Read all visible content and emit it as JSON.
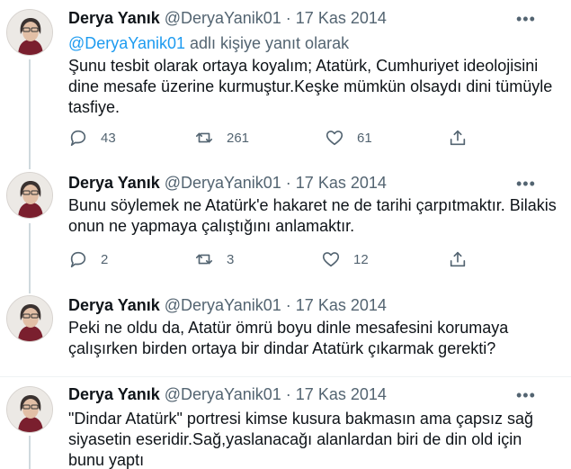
{
  "tweets": [
    {
      "name": "Derya Yanık",
      "handle": "@DeryaYanik01",
      "separator": "·",
      "date": "17 Kas 2014",
      "reply_mention": "@DeryaYanik01",
      "reply_suffix": " adlı kişiye yanıt olarak",
      "text": "Şunu tesbit olarak ortaya koyalım; Atatürk, Cumhuriyet ideolojisini dine mesafe üzerine kurmuştur.Keşke mümkün olsaydı dini tümüyle tasfiye.",
      "replies": "43",
      "retweets": "261",
      "likes": "61"
    },
    {
      "name": "Derya Yanık",
      "handle": "@DeryaYanik01",
      "separator": "·",
      "date": "17 Kas 2014",
      "text": "Bunu söylemek ne Atatürk'e hakaret ne de tarihi çarpıtmaktır. Bilakis onun ne yapmaya çalıştığını anlamaktır.",
      "replies": "2",
      "retweets": "3",
      "likes": "12"
    },
    {
      "name": "Derya Yanık",
      "handle": "@DeryaYanik01",
      "separator": "·",
      "date": "17 Kas 2014",
      "text": "Peki ne oldu da, Atatür ömrü boyu dinle mesafesini korumaya çalışırken birden ortaya bir dindar Atatürk çıkarmak gerekti?"
    },
    {
      "name": "Derya Yanık",
      "handle": "@DeryaYanik01",
      "separator": "·",
      "date": "17 Kas 2014",
      "text": "\"Dindar Atatürk\" portresi kimse kusura bakmasın ama çapsız sağ siyasetin eseridir.Sağ,yaslanacağı alanlardan biri de din old için bunu yaptı"
    }
  ],
  "icons": {
    "more": "more-horizontal-icon",
    "reply": "reply-icon",
    "retweet": "retweet-icon",
    "like": "heart-icon",
    "share": "share-icon"
  },
  "colors": {
    "link": "#1d9bf0",
    "secondary": "#536471",
    "thread_line": "#cfd9de"
  }
}
